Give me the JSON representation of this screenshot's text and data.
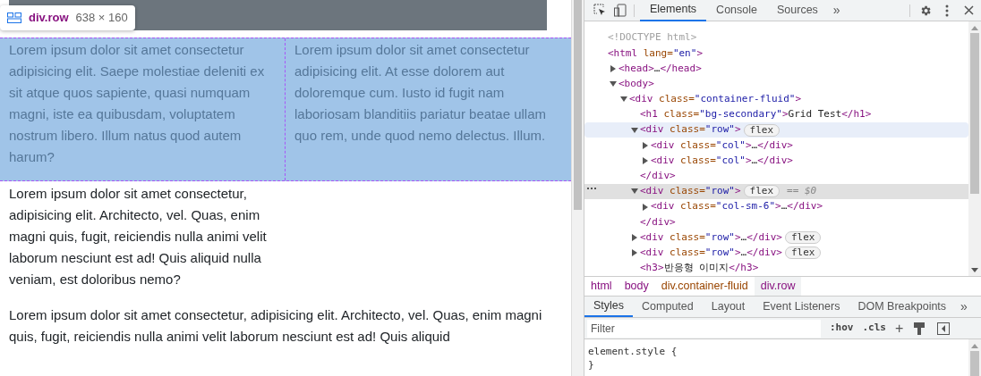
{
  "page": {
    "tooltip": {
      "selector": "div.row",
      "size": "638 × 160"
    },
    "highlighted_row": {
      "columns": [
        "Lorem ipsum dolor sit amet consectetur adipisicing elit. Saepe molestiae deleniti ex sit atque quos sapiente, quasi numquam magni, iste ea quibusdam, voluptatem nostrum libero. Illum natus quod autem harum?",
        "Lorem ipsum dolor sit amet consectetur adipisicing elit. At esse dolorem aut doloremque cum. Iusto id fugit nam laboriosam blanditiis pariatur beatae ullam quo rem, unde quod nemo delectus. Illum."
      ]
    },
    "paragraphs": [
      {
        "kind": "narrow",
        "text": "Lorem ipsum dolor sit amet consectetur, adipisicing elit. Architecto, vel. Quas, enim magni quis, fugit, reiciendis nulla animi velit laborum nesciunt est ad! Quis aliquid nulla veniam, est doloribus nemo?"
      },
      {
        "kind": "wide",
        "text": "Lorem ipsum dolor sit amet consectetur, adipisicing elit. Architecto, vel. Quas, enim magni quis, fugit, reiciendis nulla animi velit laborum nesciunt est ad! Quis aliquid"
      }
    ]
  },
  "devtools": {
    "tabs": [
      {
        "label": "Elements",
        "selected": true
      },
      {
        "label": "Console",
        "selected": false
      },
      {
        "label": "Sources",
        "selected": false
      }
    ],
    "more_tabs": "»",
    "tree": [
      {
        "kind": "doctype",
        "markup": "<!DOCTYPE html>",
        "selected": false,
        "hovered": false
      },
      {
        "kind": "element",
        "markup": "<html lang=\"en\">",
        "selected": false,
        "hovered": false,
        "children": [
          {
            "kind": "element",
            "markup": "<head>…</head>",
            "expanded": false,
            "selected": false,
            "hovered": false
          },
          {
            "kind": "element",
            "markup": "<body>",
            "expanded": true,
            "selected": false,
            "hovered": false,
            "children": [
              {
                "kind": "element",
                "markup": "<div class=\"container-fluid\">",
                "expanded": true,
                "selected": false,
                "hovered": false,
                "children": [
                  {
                    "kind": "element",
                    "markup": "<h1 class=\"bg-secondary\">Grid Test</h1>",
                    "selected": false,
                    "hovered": false
                  },
                  {
                    "kind": "element",
                    "markup": "<div class=\"row\">",
                    "badge": "flex",
                    "expanded": true,
                    "selected": false,
                    "hovered": true,
                    "closing": "</div>",
                    "children": [
                      {
                        "kind": "element",
                        "markup": "<div class=\"col\">…</div>",
                        "expanded": false,
                        "selected": false,
                        "hovered": false
                      },
                      {
                        "kind": "element",
                        "markup": "<div class=\"col\">…</div>",
                        "expanded": false,
                        "selected": false,
                        "hovered": false
                      }
                    ]
                  },
                  {
                    "kind": "element",
                    "markup": "<div class=\"row\">",
                    "badge": "flex",
                    "suffix": "== $0",
                    "expanded": true,
                    "selected": true,
                    "hovered": false,
                    "closing": "</div>",
                    "children": [
                      {
                        "kind": "element",
                        "markup": "<div class=\"col-sm-6\">…</div>",
                        "expanded": false,
                        "selected": false,
                        "hovered": false
                      }
                    ]
                  },
                  {
                    "kind": "element",
                    "markup": "<div class=\"row\">…</div>",
                    "badge": "flex",
                    "expanded": false,
                    "selected": false,
                    "hovered": false
                  },
                  {
                    "kind": "element",
                    "markup": "<div class=\"row\">…</div>",
                    "badge": "flex",
                    "expanded": false,
                    "selected": false,
                    "hovered": false
                  },
                  {
                    "kind": "element",
                    "markup": "<h3>반응형 이미지</h3>",
                    "selected": false,
                    "hovered": false
                  }
                ]
              }
            ]
          }
        ]
      }
    ],
    "breadcrumbs": [
      {
        "label": "html",
        "selected": false
      },
      {
        "label": "body",
        "selected": false
      },
      {
        "label": "div.container-fluid",
        "selected": false
      },
      {
        "label": "div.row",
        "selected": true
      }
    ],
    "style_tabs": [
      {
        "label": "Styles",
        "selected": true
      },
      {
        "label": "Computed",
        "selected": false
      },
      {
        "label": "Layout",
        "selected": false
      },
      {
        "label": "Event Listeners",
        "selected": false
      },
      {
        "label": "DOM Breakpoints",
        "selected": false
      }
    ],
    "more_style_tabs": "»",
    "filter": {
      "placeholder": "Filter",
      "hov": ":hov",
      "cls": ".cls",
      "add": "+"
    },
    "styles": [
      "element.style {",
      "}"
    ]
  }
}
